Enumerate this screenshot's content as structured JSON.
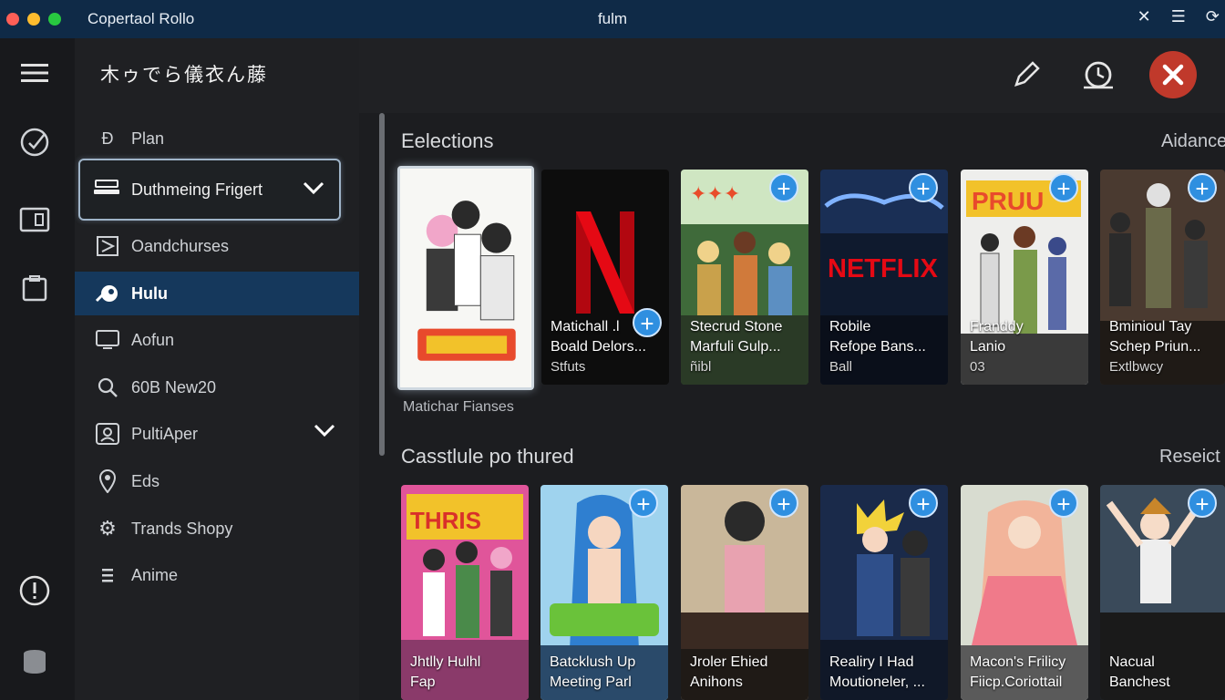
{
  "titlebar": {
    "app_name": "Copertaol Rollo",
    "window_title": "fulm",
    "colors": {
      "red": "#ff5f57",
      "yellow": "#febc2e",
      "green": "#28c840"
    }
  },
  "rail": {
    "icons": [
      "menu-icon",
      "speed-check-icon",
      "folder-icon",
      "clipboard-icon",
      "alert-icon",
      "database-icon"
    ]
  },
  "sidebar": {
    "title": "木ゥでら儀衣ん藤",
    "items": [
      {
        "label": "Plan",
        "icon": "plan-icon"
      },
      {
        "label": "Duthmeing Frigert",
        "icon": "stack-icon"
      },
      {
        "label": "Oandchurses",
        "icon": "play-box-icon"
      },
      {
        "label": "Hulu",
        "icon": "hulu-icon"
      },
      {
        "label": "Aofun",
        "icon": "monitor-icon"
      },
      {
        "label": "60B New20",
        "icon": "search-icon"
      },
      {
        "label": "PultiAper",
        "icon": "group-icon"
      },
      {
        "label": "Eds",
        "icon": "location-pin-icon"
      },
      {
        "label": "Trands Shopy",
        "icon": "gear-icon"
      },
      {
        "label": "Anime",
        "icon": "list-icon"
      }
    ]
  },
  "main": {
    "sections": [
      {
        "title": "Eelections",
        "right_label": "Aidance",
        "cards": [
          {
            "title": "",
            "line2": "",
            "sub": ""
          },
          {
            "title": "Matichall .l",
            "line2": "Boald Delors...",
            "sub": "Stfuts",
            "logo": "N"
          },
          {
            "title": "Stecrud Stone",
            "line2": "Marfuli Gulp...",
            "sub": "ñibl"
          },
          {
            "title": "Robile",
            "line2": "Refope Bans...",
            "sub": "Ball",
            "logo": "NETFLIX"
          },
          {
            "title": "Franddy",
            "line2": "Lanio",
            "sub": "03"
          },
          {
            "title": "Bminioul Tay",
            "line2": "Schep Priun...",
            "sub": "Extlbwcy"
          }
        ],
        "selected_caption": "Matichar Fianses"
      },
      {
        "title": "Casstlule po thured",
        "right_label": "Reseict",
        "cards": [
          {
            "title": "Jhtlly Hulhl",
            "line2": "Fap",
            "sub": ""
          },
          {
            "title": "Batcklush Up",
            "line2": "Meeting Parl",
            "sub": ""
          },
          {
            "title": "Jroler Ehied",
            "line2": "Anihons",
            "sub": ""
          },
          {
            "title": "Realiry I Had",
            "line2": "Moutioneler, ...",
            "sub": ""
          },
          {
            "title": "Macon's Frilicy",
            "line2": "Fiicp.Coriottail",
            "sub": ""
          },
          {
            "title": "Nacual",
            "line2": "Banchest",
            "sub": ""
          }
        ]
      }
    ],
    "add_label": "+"
  }
}
